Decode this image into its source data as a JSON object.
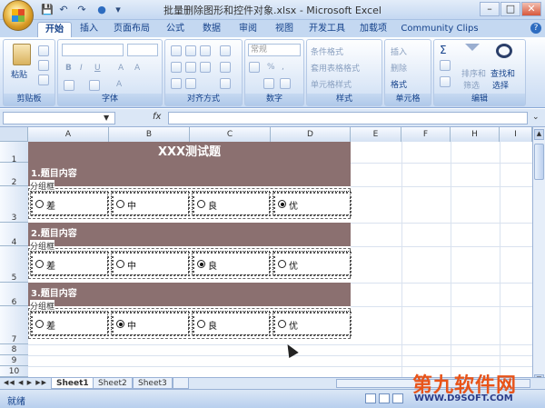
{
  "window": {
    "title": "批量删除图形和控件对象.xlsx - Microsoft Excel",
    "controls": [
      "–",
      "□",
      "✕"
    ]
  },
  "qat": [
    "💾",
    "↶",
    "↷",
    "●",
    "▾"
  ],
  "tabs": [
    "开始",
    "插入",
    "页面布局",
    "公式",
    "数据",
    "审阅",
    "视图",
    "开发工具",
    "加载项",
    "Community Clips"
  ],
  "ribbon": {
    "clipboard": {
      "paste": "粘贴",
      "group": "剪贴板"
    },
    "font": {
      "group": "字体",
      "bold": "B",
      "italic": "I",
      "underline": "U",
      "grow": "A",
      "shrink": "A",
      "fill": "A"
    },
    "alignment": {
      "group": "对齐方式"
    },
    "number": {
      "format": "常规",
      "pct": "%",
      "comma": ",",
      "group": "数字"
    },
    "styles": {
      "cond": "条件格式",
      "table": "套用表格格式",
      "cell": "单元格样式",
      "group": "样式"
    },
    "cells": {
      "insert": "插入",
      "delete": "删除",
      "format": "格式",
      "group": "单元格"
    },
    "editing": {
      "sigma": "Σ",
      "sort": "排序和",
      "sort2": "筛选",
      "find": "查找和",
      "find2": "选择",
      "group": "编辑"
    }
  },
  "formula_bar": {
    "fx": "fx",
    "namebox": ""
  },
  "columns": [
    "A",
    "B",
    "C",
    "D",
    "E",
    "F",
    "H",
    "I"
  ],
  "rows": [
    "1",
    "2",
    "3",
    "4",
    "5",
    "6",
    "7",
    "8",
    "9",
    "10"
  ],
  "sheet": {
    "title": "XXX测试题",
    "sections": [
      {
        "heading": "1.题目内容",
        "group_label": "分组框",
        "options": [
          "差",
          "中",
          "良",
          "优"
        ],
        "selected": 3
      },
      {
        "heading": "2.题目内容",
        "group_label": "分组框",
        "options": [
          "差",
          "中",
          "良",
          "优"
        ],
        "selected": 2
      },
      {
        "heading": "3.题目内容",
        "group_label": "分组框",
        "options": [
          "差",
          "中",
          "良",
          "优"
        ],
        "selected": 1
      }
    ]
  },
  "sheet_tabs": [
    "Sheet1",
    "Sheet2",
    "Sheet3"
  ],
  "status": {
    "ready": "就绪"
  },
  "watermark": {
    "line1": "第九软件网",
    "line2": "WWW.D9SOFT.COM"
  },
  "colors": {
    "banner": "#8b7070",
    "ribbon": "#dbe7f7"
  }
}
